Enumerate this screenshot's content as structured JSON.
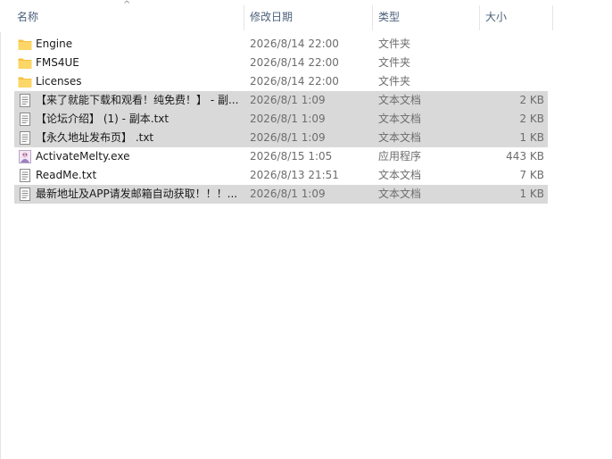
{
  "columns": {
    "name": "名称",
    "date": "修改日期",
    "type": "类型",
    "size": "大小"
  },
  "sort_indicator": "^",
  "files": [
    {
      "name": "Engine",
      "date": "2026/8/14 22:00",
      "type": "文件夹",
      "size": "",
      "icon": "folder-icon",
      "selected": false
    },
    {
      "name": "FMS4UE",
      "date": "2026/8/14 22:00",
      "type": "文件夹",
      "size": "",
      "icon": "folder-icon",
      "selected": false
    },
    {
      "name": "Licenses",
      "date": "2026/8/14 22:00",
      "type": "文件夹",
      "size": "",
      "icon": "folder-icon",
      "selected": false
    },
    {
      "name": "【来了就能下载和观看！纯免费！】 - 副...",
      "date": "2026/8/1 1:09",
      "type": "文本文档",
      "size": "2 KB",
      "icon": "text-file-icon",
      "selected": true
    },
    {
      "name": "【论坛介绍】 (1) - 副本.txt",
      "date": "2026/8/1 1:09",
      "type": "文本文档",
      "size": "2 KB",
      "icon": "text-file-icon",
      "selected": true
    },
    {
      "name": "【永久地址发布页】 .txt",
      "date": "2026/8/1 1:09",
      "type": "文本文档",
      "size": "1 KB",
      "icon": "text-file-icon",
      "selected": true
    },
    {
      "name": "ActivateMelty.exe",
      "date": "2026/8/15 1:05",
      "type": "应用程序",
      "size": "443 KB",
      "icon": "app-icon",
      "selected": false
    },
    {
      "name": "ReadMe.txt",
      "date": "2026/8/13 21:51",
      "type": "文本文档",
      "size": "7 KB",
      "icon": "text-file-icon",
      "selected": false
    },
    {
      "name": "最新地址及APP请发邮箱自动获取！！！...",
      "date": "2026/8/1 1:09",
      "type": "文本文档",
      "size": "1 KB",
      "icon": "text-file-icon",
      "selected": true
    }
  ]
}
